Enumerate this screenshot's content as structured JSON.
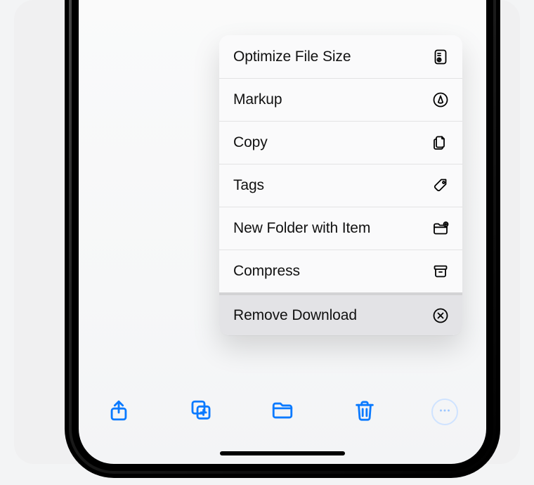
{
  "menu": {
    "items": [
      {
        "label": "Optimize File Size",
        "icon": "doc-compress-icon"
      },
      {
        "label": "Markup",
        "icon": "markup-icon"
      },
      {
        "label": "Copy",
        "icon": "copy-icon"
      },
      {
        "label": "Tags",
        "icon": "tag-icon"
      },
      {
        "label": "New Folder with Item",
        "icon": "new-folder-icon"
      },
      {
        "label": "Compress",
        "icon": "archive-icon"
      },
      {
        "label": "Remove Download",
        "icon": "remove-icon"
      }
    ]
  },
  "toolbar": {
    "share": "Share",
    "duplicate": "Duplicate",
    "move": "Move",
    "delete": "Delete",
    "more": "More"
  },
  "colors": {
    "accent": "#0a7aff"
  }
}
